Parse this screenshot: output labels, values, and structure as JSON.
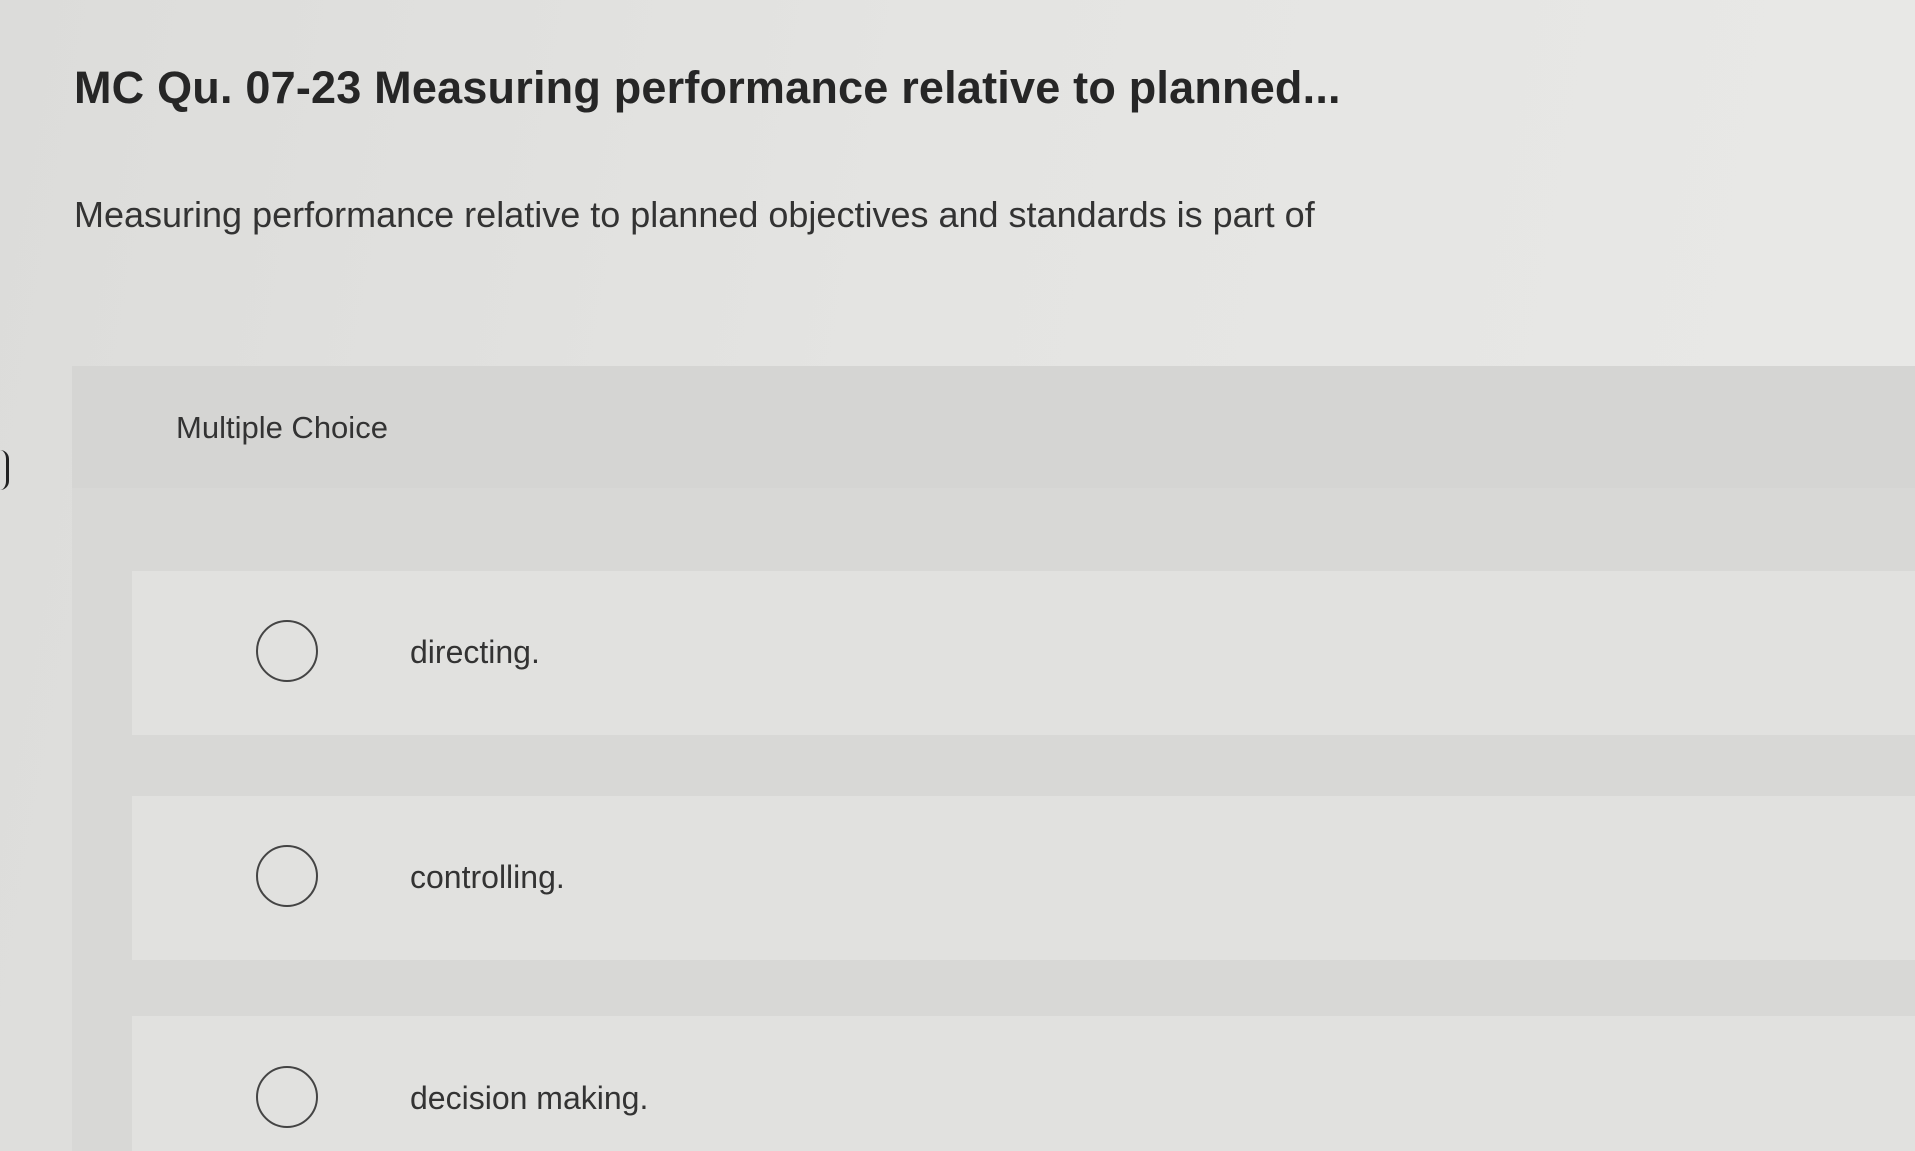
{
  "question": {
    "title": "MC Qu. 07-23 Measuring performance relative to planned...",
    "prompt": "Measuring performance relative to planned objectives and standards is part of"
  },
  "answer_panel": {
    "type_label": "Multiple Choice",
    "options": [
      {
        "label": "directing.",
        "selected": false
      },
      {
        "label": "controlling.",
        "selected": false
      },
      {
        "label": "decision making.",
        "selected": false
      }
    ]
  }
}
